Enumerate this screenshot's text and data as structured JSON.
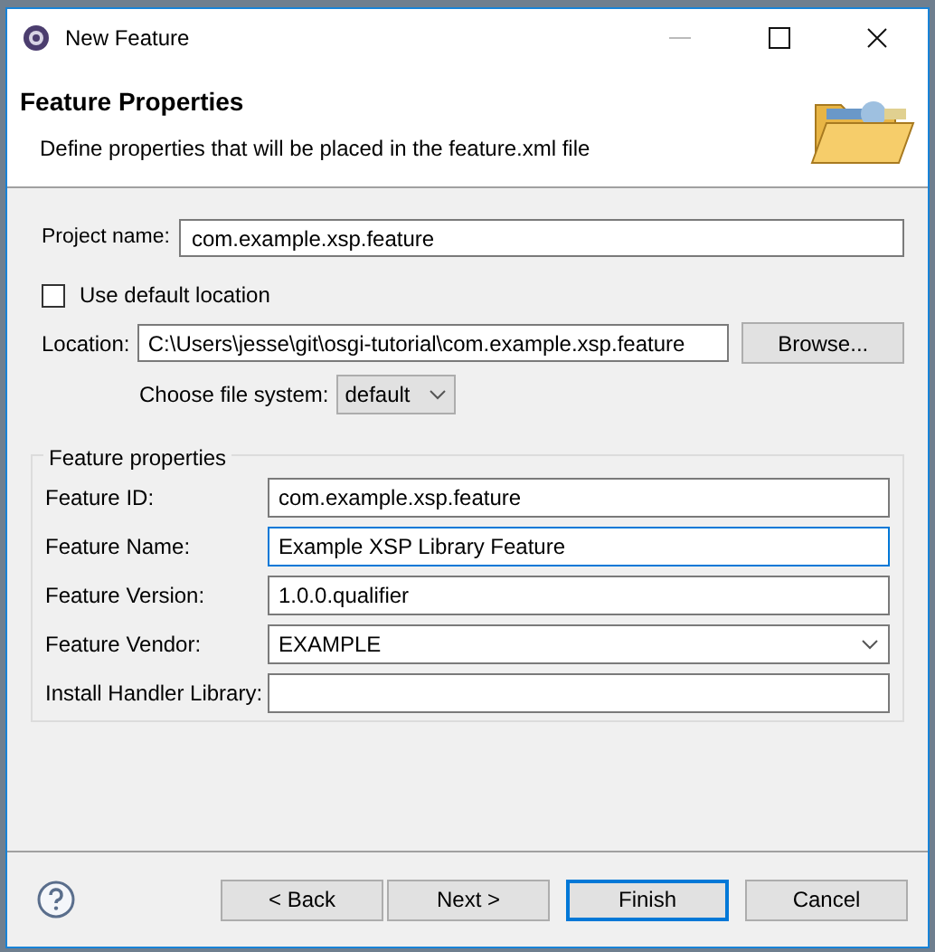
{
  "window": {
    "title": "New Feature"
  },
  "header": {
    "title": "Feature Properties",
    "description": "Define properties that will be placed in the feature.xml file"
  },
  "project_name": {
    "label": "Project name:",
    "value": "com.example.xsp.feature"
  },
  "use_default_location": {
    "label": "Use default location",
    "checked": false
  },
  "location": {
    "label": "Location:",
    "value": "C:\\Users\\jesse\\git\\osgi-tutorial\\com.example.xsp.feature",
    "button": "Browse..."
  },
  "file_system": {
    "label": "Choose file system:",
    "value": "default"
  },
  "feature_properties": {
    "title": "Feature properties",
    "fields": [
      {
        "label": "Feature ID:",
        "value": "com.example.xsp.feature",
        "kind": "text",
        "focused": false
      },
      {
        "label": "Feature Name:",
        "value": "Example XSP Library Feature",
        "kind": "text",
        "focused": true
      },
      {
        "label": "Feature Version:",
        "value": "1.0.0.qualifier",
        "kind": "text",
        "focused": false
      },
      {
        "label": "Feature Vendor:",
        "value": "EXAMPLE",
        "kind": "combo",
        "focused": false
      },
      {
        "label": "Install Handler Library:",
        "kind": "text",
        "focused": false
      }
    ]
  },
  "buttons": [
    {
      "label": "< Back",
      "default": false
    },
    {
      "label": "Next >",
      "default": false
    },
    {
      "label": "Finish",
      "default": true
    },
    {
      "label": "Cancel",
      "default": false
    }
  ]
}
